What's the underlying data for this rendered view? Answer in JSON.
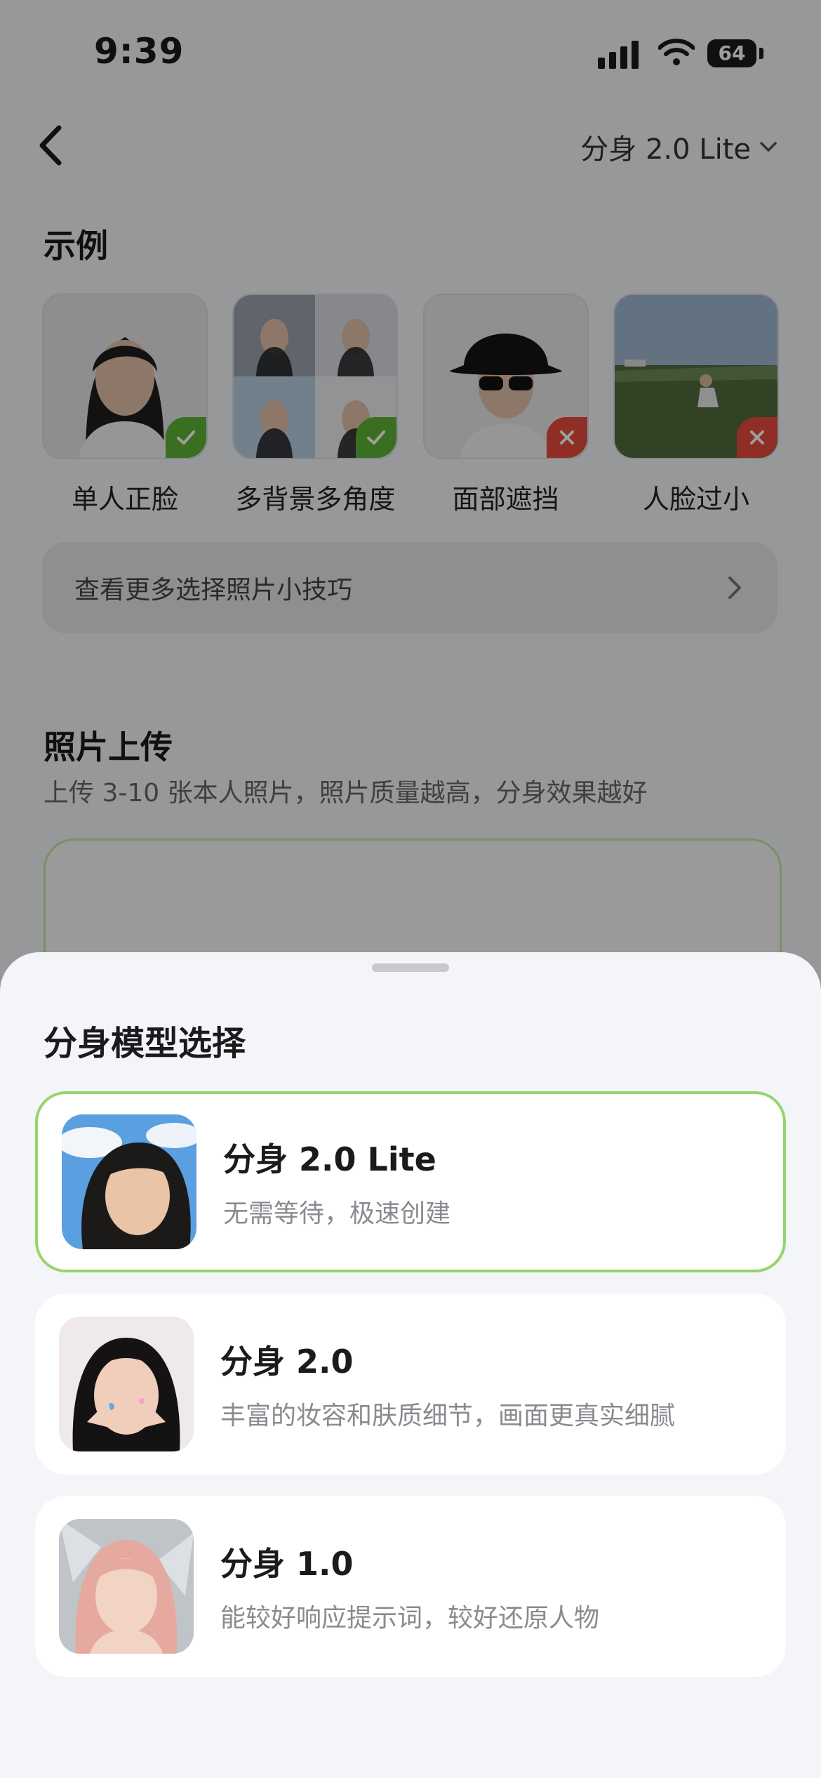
{
  "status": {
    "time": "9:39",
    "battery": "64"
  },
  "header": {
    "model_label": "分身 2.0 Lite"
  },
  "examples_section": {
    "title": "示例",
    "items": [
      {
        "label": "单人正脸",
        "status": "ok"
      },
      {
        "label": "多背景多角度",
        "status": "ok"
      },
      {
        "label": "面部遮挡",
        "status": "bad"
      },
      {
        "label": "人脸过小",
        "status": "bad"
      }
    ],
    "tips": "查看更多选择照片小技巧"
  },
  "upload": {
    "title": "照片上传",
    "subtitle": "上传 3-10 张本人照片，照片质量越高，分身效果越好"
  },
  "sheet": {
    "title": "分身模型选择",
    "options": [
      {
        "title": "分身 2.0 Lite",
        "desc": "无需等待，极速创建",
        "selected": true
      },
      {
        "title": "分身 2.0",
        "desc": "丰富的妆容和肤质细节，画面更真实细腻",
        "selected": false
      },
      {
        "title": "分身 1.0",
        "desc": "能较好响应提示词，较好还原人物",
        "selected": false
      }
    ]
  },
  "colors": {
    "accent_green": "#95d56c",
    "ok_badge": "#5eb336",
    "bad_badge": "#e54b3c"
  }
}
